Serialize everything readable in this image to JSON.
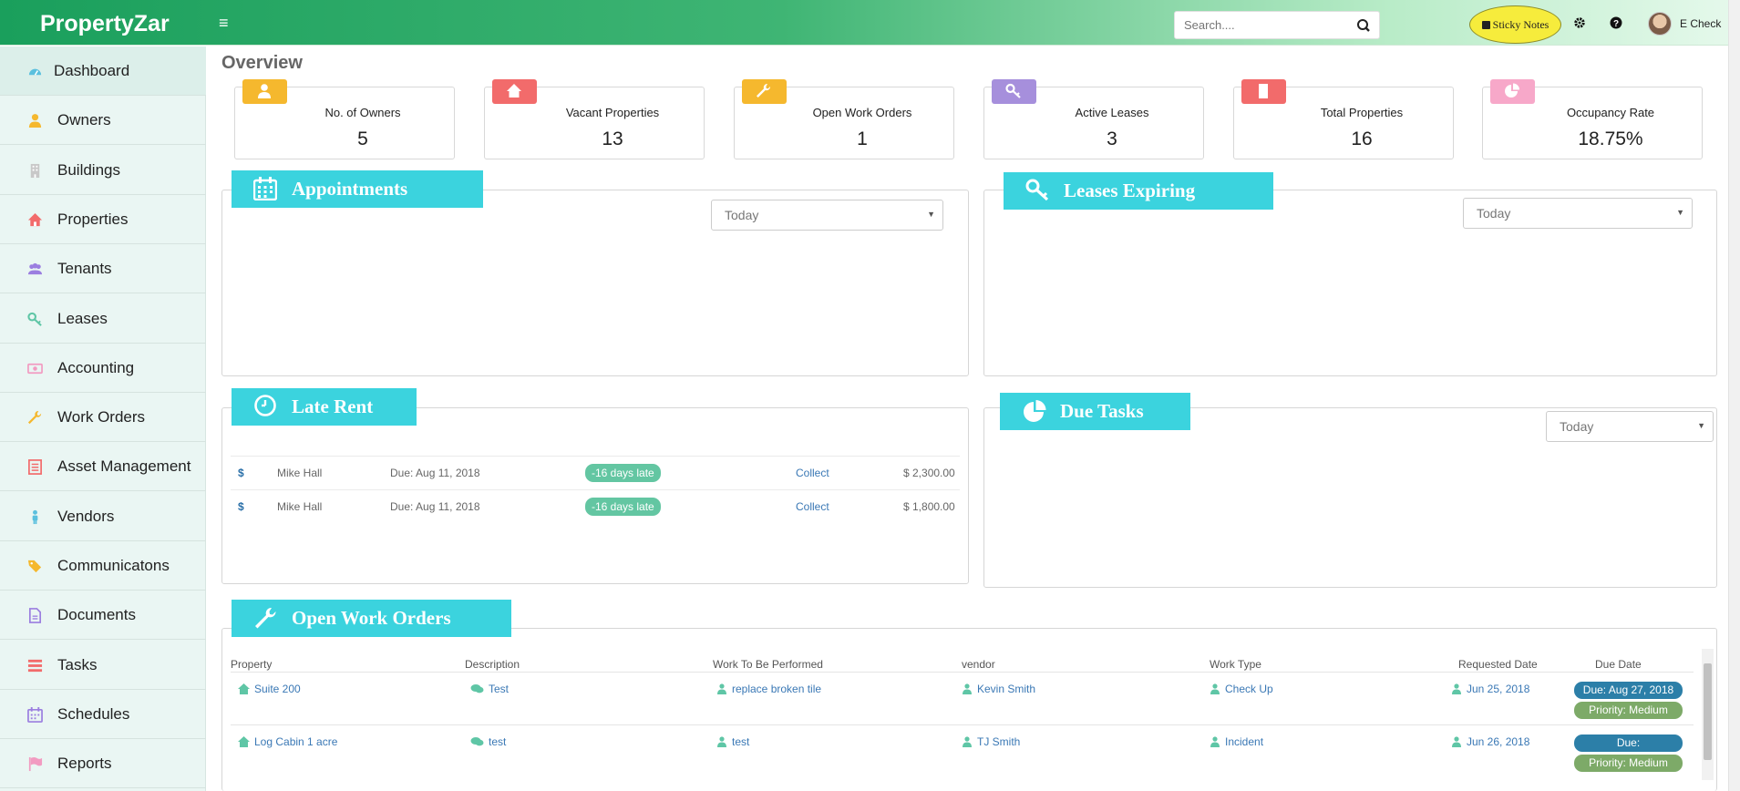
{
  "header": {
    "brand": "PropertyZar",
    "search_placeholder": "Search....",
    "sticky_notes": "Sticky Notes",
    "user_name": "E Check"
  },
  "sidebar": {
    "items": [
      {
        "label": "Dashboard",
        "icon": "dashboard-icon",
        "color": "#5bc0de"
      },
      {
        "label": "Owners",
        "icon": "owner-icon",
        "color": "#f5b82e"
      },
      {
        "label": "Buildings",
        "icon": "building-icon",
        "color": "#c8c8c8"
      },
      {
        "label": "Properties",
        "icon": "home-icon",
        "color": "#f26b6b"
      },
      {
        "label": "Tenants",
        "icon": "tenants-icon",
        "color": "#9b7ee0"
      },
      {
        "label": "Leases",
        "icon": "key-icon",
        "color": "#5fc6a6"
      },
      {
        "label": "Accounting",
        "icon": "money-icon",
        "color": "#f29bc1"
      },
      {
        "label": "Work Orders",
        "icon": "wrench-icon",
        "color": "#f5b82e"
      },
      {
        "label": "Asset Management",
        "icon": "list-icon",
        "color": "#f26b6b"
      },
      {
        "label": "Vendors",
        "icon": "person-icon",
        "color": "#5bc0de"
      },
      {
        "label": "Communicatons",
        "icon": "tag-icon",
        "color": "#f5b82e"
      },
      {
        "label": "Documents",
        "icon": "document-icon",
        "color": "#9b7ee0"
      },
      {
        "label": "Tasks",
        "icon": "tasks-icon",
        "color": "#f26b6b"
      },
      {
        "label": "Schedules",
        "icon": "calendar-icon",
        "color": "#9b7ee0"
      },
      {
        "label": "Reports",
        "icon": "flag-icon",
        "color": "#f29bc1"
      }
    ]
  },
  "page": {
    "title": "Overview"
  },
  "stats": [
    {
      "title": "No. of Owners",
      "value": "5",
      "icon": "owner-icon",
      "color": "#f5b82e"
    },
    {
      "title": "Vacant Properties",
      "value": "13",
      "icon": "home-icon",
      "color": "#f26b6b"
    },
    {
      "title": "Open Work Orders",
      "value": "1",
      "icon": "wrench-icon",
      "color": "#f5b82e"
    },
    {
      "title": "Active Leases",
      "value": "3",
      "icon": "key-icon",
      "color": "#a68fdc"
    },
    {
      "title": "Total Properties",
      "value": "16",
      "icon": "building-icon",
      "color": "#f26b6b"
    },
    {
      "title": "Occupancy Rate",
      "value": "18.75%",
      "icon": "pie-icon",
      "color": "#f7a8c9"
    }
  ],
  "panels": {
    "appointments": {
      "title": "Appointments",
      "filter": "Today"
    },
    "leases_expiring": {
      "title": "Leases Expiring",
      "filter": "Today"
    },
    "late_rent": {
      "title": "Late Rent",
      "rows": [
        {
          "symbol": "$",
          "name": "Mike Hall",
          "due": "Due: Aug 11, 2018",
          "late": "-16 days late",
          "action": "Collect",
          "amount": "$ 2,300.00"
        },
        {
          "symbol": "$",
          "name": "Mike Hall",
          "due": "Due: Aug 11, 2018",
          "late": "-16 days late",
          "action": "Collect",
          "amount": "$ 1,800.00"
        }
      ]
    },
    "due_tasks": {
      "title": "Due Tasks",
      "filter": "Today"
    },
    "open_work_orders": {
      "title": "Open Work Orders",
      "columns": [
        "Property",
        "Description",
        "Work To Be Performed",
        "vendor",
        "Work Type",
        "Requested Date",
        "Due Date"
      ],
      "rows": [
        {
          "property": "Suite 200",
          "description": "Test",
          "work": "replace broken tile",
          "vendor": "Kevin Smith",
          "type": "Check Up",
          "requested": "Jun 25, 2018",
          "due": "Due: Aug 27, 2018",
          "priority": "Priority: Medium"
        },
        {
          "property": "Log Cabin 1 acre",
          "description": "test",
          "work": "test",
          "vendor": "TJ Smith",
          "type": "Incident",
          "requested": "Jun 26, 2018",
          "due": "Due:",
          "priority": "Priority: Medium"
        }
      ]
    }
  },
  "colors": {
    "accent": "#3bd3de",
    "brand_green": "#1a9f5c",
    "link": "#3a78b5",
    "late_pill": "#63c6a2"
  }
}
